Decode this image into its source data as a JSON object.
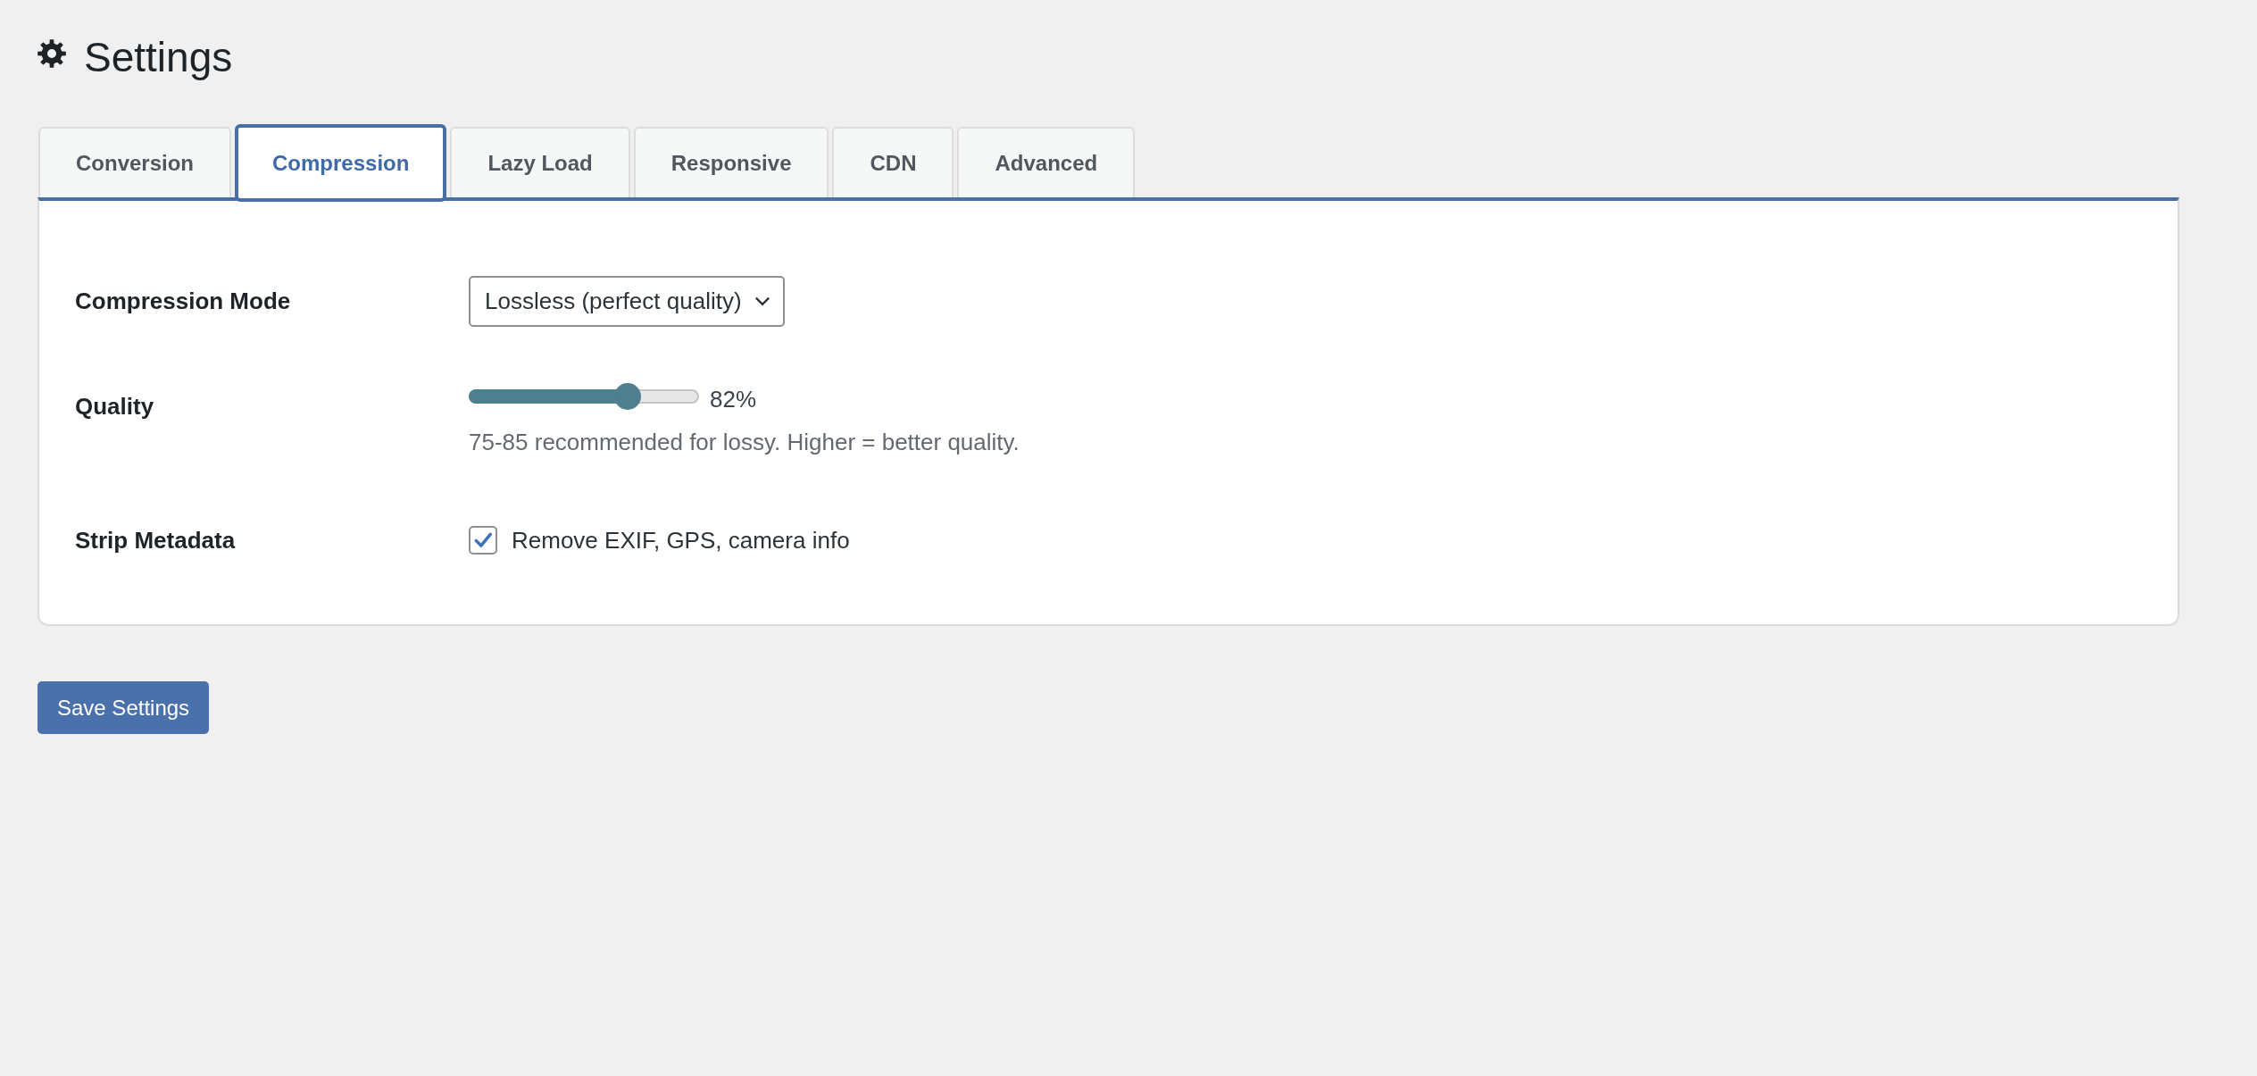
{
  "page": {
    "title": "Settings"
  },
  "tabs": [
    {
      "label": "Conversion",
      "selected": false
    },
    {
      "label": "Compression",
      "selected": true
    },
    {
      "label": "Lazy Load",
      "selected": false
    },
    {
      "label": "Responsive",
      "selected": false
    },
    {
      "label": "CDN",
      "selected": false
    },
    {
      "label": "Advanced",
      "selected": false
    }
  ],
  "settings": [
    {
      "kind": "select",
      "label": "Compression Mode",
      "value": "Lossless (perfect quality)"
    },
    {
      "kind": "slider",
      "label": "Quality",
      "level": 0.69,
      "reading": "82%",
      "hint": "75-85 recommended for lossy. Higher = better quality."
    },
    {
      "kind": "checkbox",
      "label": "Strip Metadata",
      "checked": true,
      "text": "Remove EXIF, GPS, camera info"
    }
  ],
  "save_button": {
    "label": "Save Settings"
  }
}
